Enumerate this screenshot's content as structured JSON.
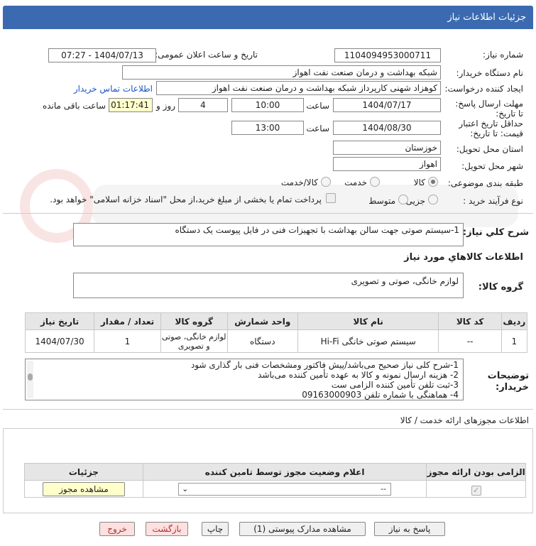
{
  "header": {
    "title": "جزئیات اطلاعات نیاز"
  },
  "form": {
    "need_number_label": "شماره نیاز:",
    "need_number": "1104094953000711",
    "announce_label": "تاریخ و ساعت اعلان عمومی:",
    "announce_value": "1404/07/13 - 07:27",
    "buyer_org_label": "نام دستگاه خریدار:",
    "buyer_org": "شبکه بهداشت و درمان صنعت نفت اهواز",
    "requester_label": "ایجاد کننده درخواست:",
    "requester": "کوهزاد شهنی کارپرداز شبکه بهداشت و درمان صنعت نفت اهواز",
    "contact_link": "اطلاعات تماس خریدار",
    "deadline_label": "مهلت ارسال پاسخ: تا تاریخ:",
    "deadline_date": "1404/07/17",
    "time_label": "ساعت",
    "deadline_time": "10:00",
    "days_value": "4",
    "days_label": "روز و",
    "remaining_time": "01:17:41",
    "remaining_label": "ساعت باقی مانده",
    "validity_label": "حداقل تاریخ اعتبار قیمت: تا تاریخ:",
    "validity_date": "1404/08/30",
    "validity_time": "13:00",
    "province_label": "استان محل تحویل:",
    "province": "خوزستان",
    "city_label": "شهر محل تحویل:",
    "city": "اهواز",
    "category_label": "طبقه بندی موضوعی:",
    "cat_goods": "کالا",
    "cat_service": "خدمت",
    "cat_goods_service": "کالا/خدمت",
    "purchase_type_label": "نوع فرآیند خرید :",
    "pt_minor": "جزیی",
    "pt_medium": "متوسط",
    "payment_note": "پرداخت تمام یا بخشی از مبلغ خرید،از محل \"اسناد خزانه اسلامی\" خواهد بود."
  },
  "summary": {
    "label": "شرح کلي نياز:",
    "text": "1-سیستم صوتی جهت سالن بهداشت با تجهیزات فنی در فایل پیوست یک دستگاه"
  },
  "goods": {
    "section_title": "اطلاعات كالاهاي مورد نياز",
    "group_label": "گروه کالا:",
    "group_value": "لوازم خانگی، صوتی و تصویری",
    "columns": [
      "ردیف",
      "کد کالا",
      "نام کالا",
      "واحد شمارش",
      "گروه کالا",
      "تعداد / مقدار",
      "تاریخ نیاز"
    ],
    "rows": [
      {
        "row": "1",
        "code": "--",
        "name": "سیستم صوتی خانگی Hi-Fi",
        "unit": "دستگاه",
        "group": "لوازم خانگی، صوتی و تصویری",
        "qty": "1",
        "date": "1404/07/30"
      }
    ]
  },
  "buyer_notes": {
    "label": "توضیحات خریدار:",
    "lines": [
      "1-شرح کلی نیاز صحیح می‌باشد/پیش فاکتور ومشخصات فنی بار گذاری شود",
      "2- هزینه ارسال نمونه و کالا به عهده تأمین کننده می‌باشد",
      "3-ثبت تلفن تأمین کننده الزامی ست",
      "4- هماهنگی با شماره تلفن 09163000903"
    ]
  },
  "permits": {
    "title": "اطلاعات مجوزهای ارائه خدمت / کالا",
    "col_required": "الزامی بودن ارائه مجوز",
    "col_status": "اعلام وضعیت مجوز توسط تامین کننده",
    "col_details": "جزئیات",
    "select_value": "--",
    "view_button": "مشاهده مجوز"
  },
  "actions": {
    "reply": "پاسخ به نیاز",
    "view_docs": "مشاهده مدارک پیوستی (1)",
    "print": "چاپ",
    "back": "بازگشت",
    "exit": "خروج"
  },
  "colors": {
    "header_bg": "#3b6ab0",
    "highlight": "#ffffcc",
    "link": "#1a56c4"
  }
}
